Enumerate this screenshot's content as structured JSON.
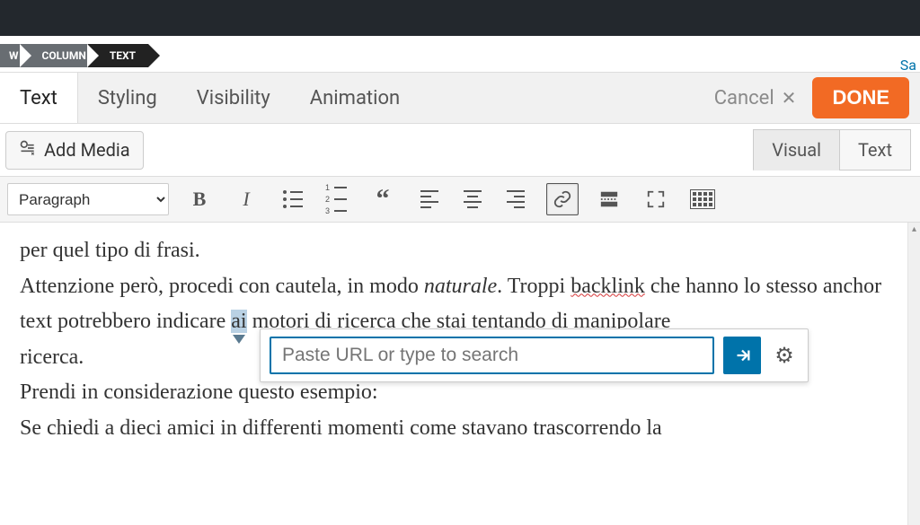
{
  "breadcrumb": {
    "items": [
      "W",
      "COLUMN",
      "TEXT"
    ]
  },
  "tabs": {
    "text": "Text",
    "styling": "Styling",
    "visibility": "Visibility",
    "animation": "Animation"
  },
  "actions": {
    "cancel": "Cancel",
    "done": "DONE"
  },
  "partial_link": "Sa",
  "media": {
    "add_media": "Add Media"
  },
  "mode_tabs": {
    "visual": "Visual",
    "text": "Text"
  },
  "toolbar": {
    "format_select": "Paragraph",
    "icons": {
      "bold": "bold-icon",
      "italic": "italic-icon",
      "ul": "unordered-list-icon",
      "ol": "ordered-list-icon",
      "quote": "blockquote-icon",
      "align_left": "align-left-icon",
      "align_center": "align-center-icon",
      "align_right": "align-right-icon",
      "link": "link-icon",
      "readmore": "read-more-icon",
      "fullscreen": "fullscreen-icon",
      "kitchen": "toolbar-toggle-icon"
    }
  },
  "link_popover": {
    "placeholder": "Paste URL or type to search",
    "apply_icon": "apply-icon",
    "settings_icon": "gear-icon"
  },
  "editor": {
    "line1": "per quel tipo di frasi.",
    "p2_a": "Attenzione però, procedi con cautela, in modo ",
    "p2_em": "naturale",
    "p2_b": ". Troppi ",
    "p2_spell": "backlink",
    "p2_c": " che hanno lo stesso anchor text potrebbero indicare ",
    "p2_sel": "ai",
    "p2_d": " motori di ricerca che stai tentando di manipolare",
    "p2_e": "ricerca.",
    "p3": "Prendi in considerazione questo esempio:",
    "p4": "Se chiedi a dieci amici in differenti momenti come stavano trascorrendo la"
  },
  "colors": {
    "accent": "#f26a24",
    "link_blue": "#0073aa"
  }
}
